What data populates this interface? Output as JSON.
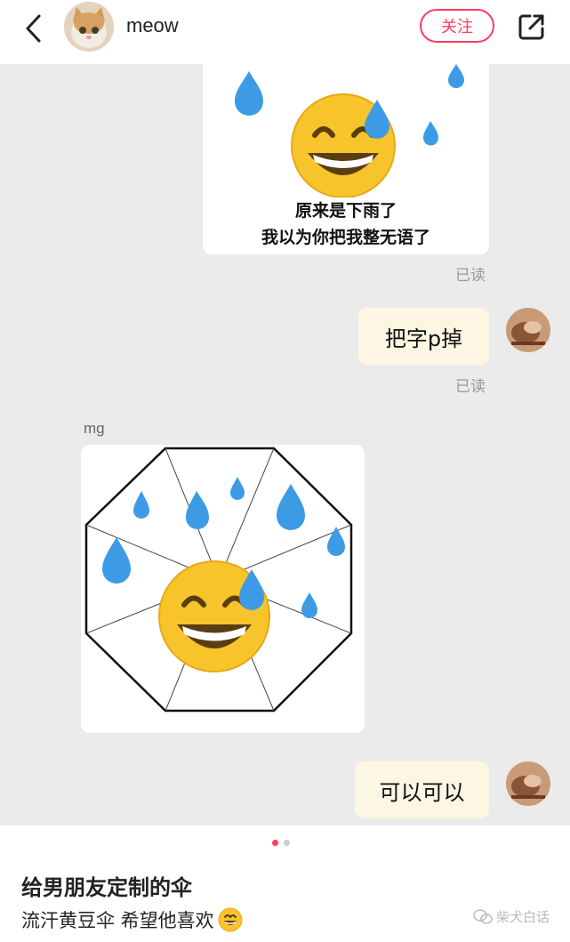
{
  "header": {
    "back_icon": "chevron-left-icon",
    "username": "meow",
    "follow_label": "关注",
    "share_icon": "share-out-icon",
    "accent": "#ff3b5c"
  },
  "chat": {
    "image1": {
      "line1": "原来是下雨了",
      "line2": "我以为你把我整无语了"
    },
    "read1": "已读",
    "message1": "把字p掉",
    "read2": "已读",
    "sender_name": "mg",
    "message2": "可以可以",
    "bubble_color": "#fdf6e3",
    "background": "#ebebeb"
  },
  "post": {
    "page_indicator": {
      "count": 2,
      "active": 1
    },
    "title": "给男朋友定制的伞",
    "description": "流汗黄豆伞 希望他喜欢",
    "watermark": "柴犬白话"
  }
}
